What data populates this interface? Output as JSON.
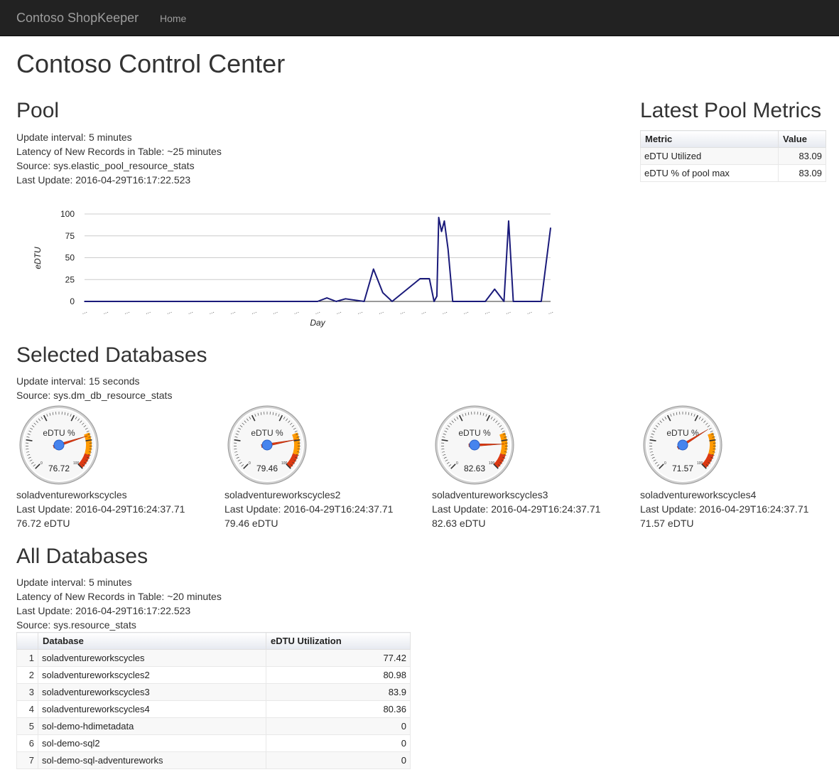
{
  "nav": {
    "brand": "Contoso ShopKeeper",
    "home": "Home"
  },
  "page_title": "Contoso Control Center",
  "pool": {
    "heading": "Pool",
    "info": [
      "Update interval: 5 minutes",
      "Latency of New Records in Table: ~25 minutes",
      "Source: sys.elastic_pool_resource_stats",
      "Last Update: 2016-04-29T16:17:22.523"
    ]
  },
  "latest": {
    "heading": "Latest Pool Metrics",
    "columns": [
      "Metric",
      "Value"
    ],
    "rows": [
      {
        "metric": "eDTU Utilized",
        "value": "83.09"
      },
      {
        "metric": "eDTU % of pool max",
        "value": "83.09"
      }
    ]
  },
  "chart_data": {
    "type": "line",
    "xlabel": "Day",
    "ylabel": "eDTU",
    "ylim": [
      0,
      100
    ],
    "yticks": [
      "100",
      "75",
      "50",
      "25",
      "0"
    ],
    "xtick_label": "...",
    "xtick_count": 23,
    "grid": true,
    "line_color": "#1a1a7a",
    "x": [
      0,
      25,
      26,
      27,
      28,
      30,
      31,
      32,
      33,
      36,
      37,
      37.5,
      37.8,
      38,
      38.3,
      38.6,
      39,
      39.5,
      40,
      41,
      42,
      43,
      44,
      45,
      45.5,
      46,
      47,
      48,
      49,
      50
    ],
    "values": [
      0,
      0,
      4,
      0,
      3,
      0,
      37,
      10,
      0,
      26,
      26,
      0,
      6,
      96,
      80,
      92,
      60,
      0,
      0,
      0,
      0,
      0,
      14,
      0,
      92,
      0,
      0,
      0,
      0,
      84
    ],
    "note_x_units": "sample index across days"
  },
  "selected": {
    "heading": "Selected Databases",
    "info": [
      "Update interval: 15 seconds",
      "Source: sys.dm_db_resource_stats"
    ],
    "gauge_title": "eDTU %",
    "gauges": [
      {
        "name": "soladventureworkscycles",
        "last_update": "Last Update: 2016-04-29T16:24:37.71",
        "value": 76.72,
        "value_text": "76.72",
        "edtu": "76.72 eDTU"
      },
      {
        "name": "soladventureworkscycles2",
        "last_update": "Last Update: 2016-04-29T16:24:37.71",
        "value": 79.46,
        "value_text": "79.46",
        "edtu": "79.46 eDTU"
      },
      {
        "name": "soladventureworkscycles3",
        "last_update": "Last Update: 2016-04-29T16:24:37.71",
        "value": 82.63,
        "value_text": "82.63",
        "edtu": "82.63 eDTU"
      },
      {
        "name": "soladventureworkscycles4",
        "last_update": "Last Update: 2016-04-29T16:24:37.71",
        "value": 71.57,
        "value_text": "71.57",
        "edtu": "71.57 eDTU"
      }
    ]
  },
  "all": {
    "heading": "All Databases",
    "info": [
      "Update interval: 5 minutes",
      "Latency of New Records in Table: ~20 minutes",
      "Last Update: 2016-04-29T16:17:22.523",
      "Source: sys.resource_stats"
    ],
    "columns": [
      "",
      "Database",
      "eDTU Utilization"
    ],
    "rows": [
      {
        "i": "1",
        "db": "soladventureworkscycles",
        "v": "77.42"
      },
      {
        "i": "2",
        "db": "soladventureworkscycles2",
        "v": "80.98"
      },
      {
        "i": "3",
        "db": "soladventureworkscycles3",
        "v": "83.9"
      },
      {
        "i": "4",
        "db": "soladventureworkscycles4",
        "v": "80.36"
      },
      {
        "i": "5",
        "db": "sol-demo-hdimetadata",
        "v": "0"
      },
      {
        "i": "6",
        "db": "sol-demo-sql2",
        "v": "0"
      },
      {
        "i": "7",
        "db": "sol-demo-sql-adventureworks",
        "v": "0"
      }
    ]
  },
  "colors": {
    "navbar": "#222222",
    "nav_text": "#9d9d9d",
    "gauge_needle": "#dc3912",
    "gauge_pivot": "#4684ee",
    "gauge_yellow": "#ff9900",
    "gauge_red": "#dc3912"
  }
}
